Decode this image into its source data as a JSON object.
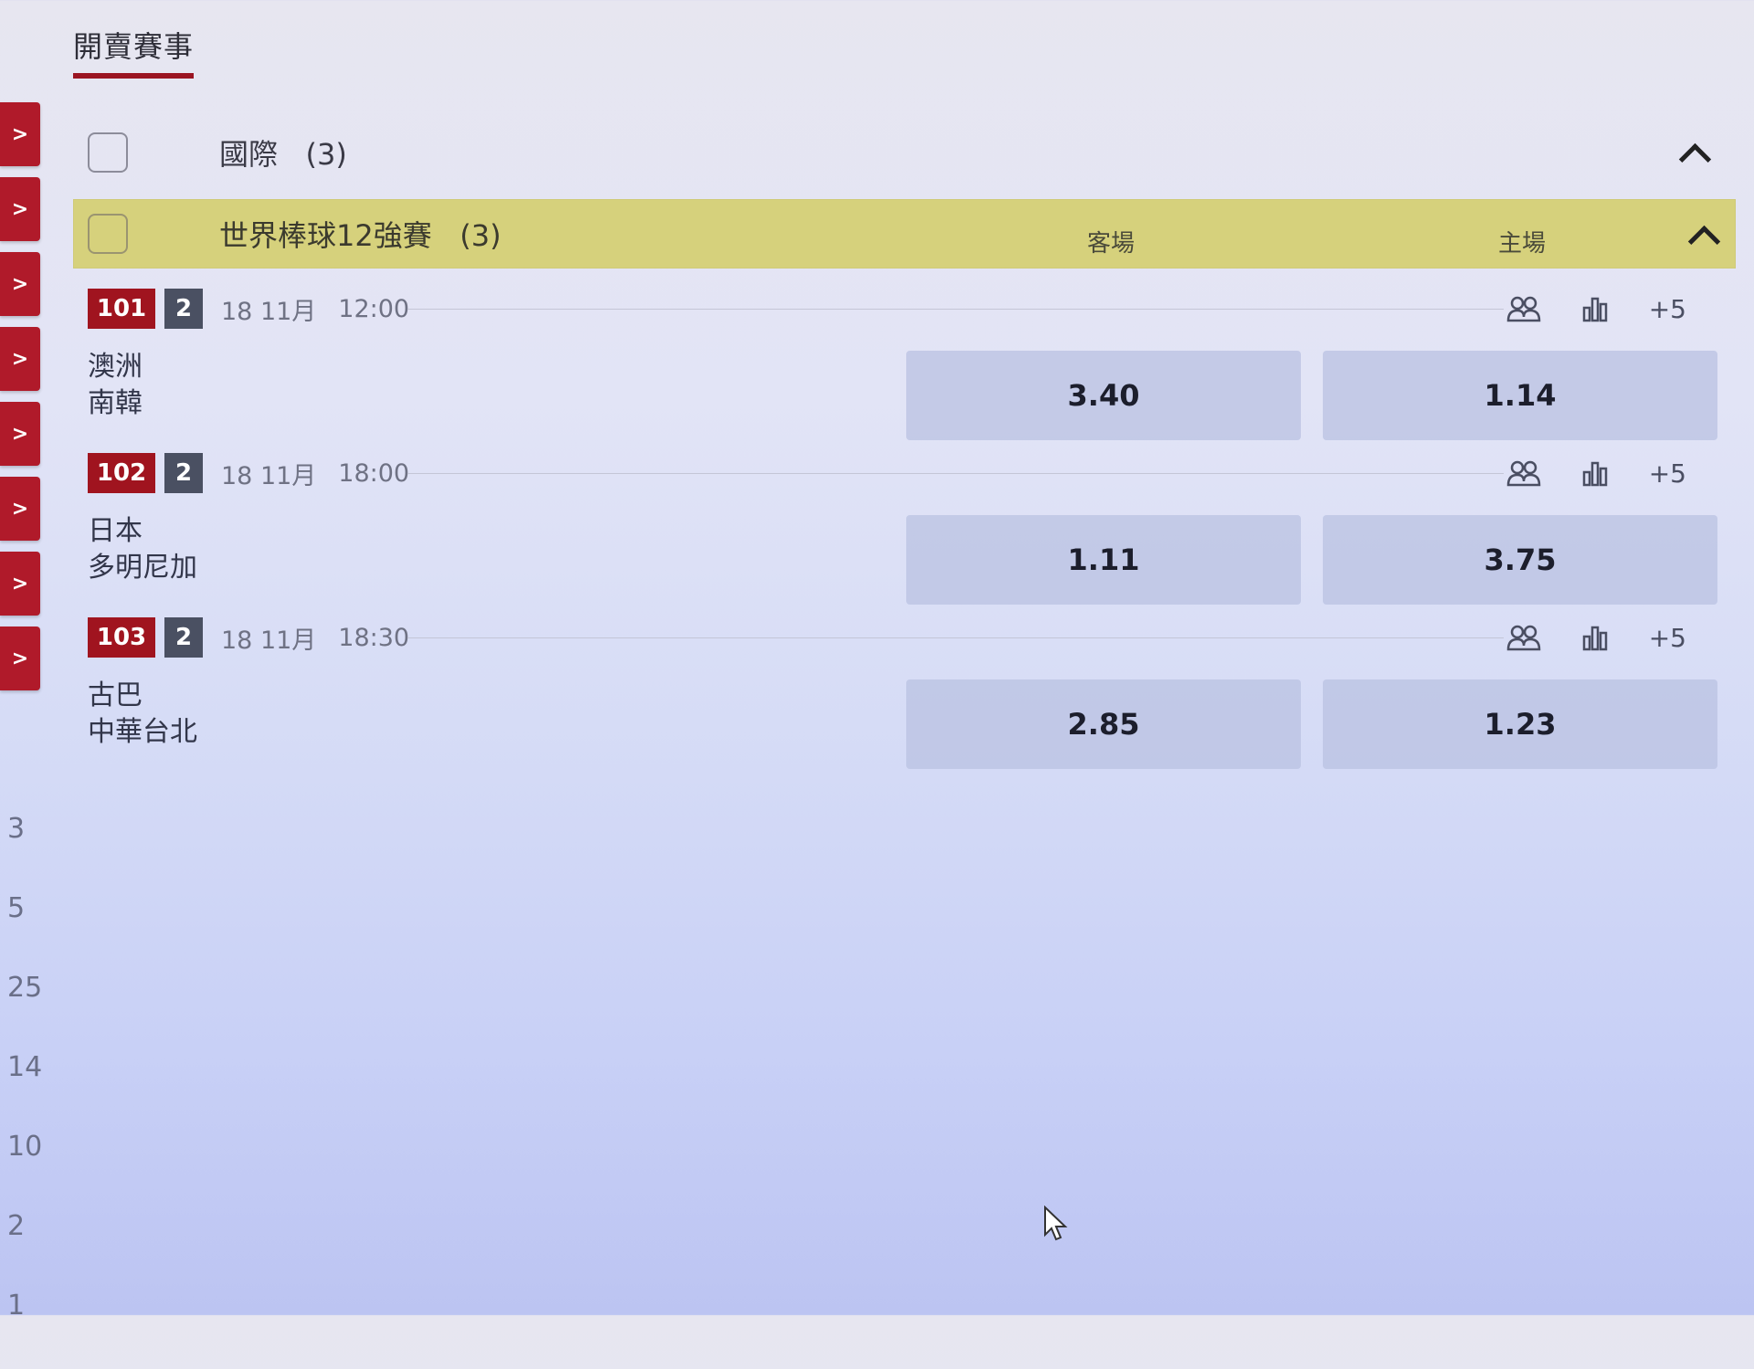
{
  "page_title": "開賣賽事",
  "side_tabs": [
    ">",
    ">",
    ">",
    ">",
    ">",
    ">",
    ">",
    ">"
  ],
  "side_numbers": [
    "3",
    "5",
    "25",
    "14",
    "10",
    "2",
    "1"
  ],
  "region": {
    "name": "國際",
    "count": "(3)"
  },
  "league": {
    "name": "世界棒球12強賽",
    "count": "(3)",
    "col_away": "客場",
    "col_home": "主場"
  },
  "matches": [
    {
      "id": "101",
      "num": "2",
      "date": "18 11月",
      "time": "12:00",
      "team_a": "澳洲",
      "team_b": "南韓",
      "odds_away": "3.40",
      "odds_home": "1.14",
      "more": "+5"
    },
    {
      "id": "102",
      "num": "2",
      "date": "18 11月",
      "time": "18:00",
      "team_a": "日本",
      "team_b": "多明尼加",
      "odds_away": "1.11",
      "odds_home": "3.75",
      "more": "+5"
    },
    {
      "id": "103",
      "num": "2",
      "date": "18 11月",
      "time": "18:30",
      "team_a": "古巴",
      "team_b": "中華台北",
      "odds_away": "2.85",
      "odds_home": "1.23",
      "more": "+5"
    }
  ],
  "icons": {
    "lineup": "people-icon",
    "stats": "bar-chart-icon",
    "collapse": "chevron-up-icon",
    "expand": "chevron-right-icon"
  },
  "colors": {
    "accent_red": "#a0141f",
    "league_bar": "#d6d17c",
    "num_badge": "#4a5062"
  }
}
